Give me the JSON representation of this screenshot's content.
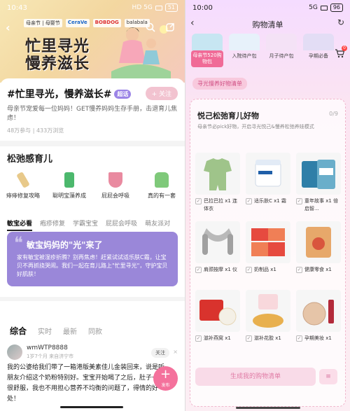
{
  "left": {
    "status": {
      "time": "10:43",
      "indicators": "HD 5G",
      "battery": "51"
    },
    "banner": {
      "brands": [
        "母亲节 | 母婴节",
        "CeraVe",
        "BOBDOG",
        "balabala"
      ],
      "title_line1": "忙里寻光",
      "title_line2": "慢养滋长"
    },
    "icons": {
      "back": "back-icon",
      "search": "search-icon",
      "share": "share-icon"
    },
    "topic": {
      "title": "#忙里寻光，慢养滋长#",
      "super_tag": "超话",
      "follow_label": "+ 关注",
      "description": "母亲节宠爱每一位妈妈！GET慢养妈妈生存手册，击退育儿焦虑！",
      "stats": "48万参与 | 433万浏览"
    },
    "section": {
      "title": "松弛感育儿",
      "items": [
        {
          "label": "痱痱修复攻略",
          "color": "#e8c98a"
        },
        {
          "label": "聪明宝藻养成",
          "color": "#4cb86d"
        },
        {
          "label": "屁屁会呼吸",
          "color": "#e98aa0"
        },
        {
          "label": "真的有一套",
          "color": "#7fc97a"
        }
      ]
    },
    "tabs": [
      "敏宝必看",
      "疱疹修复",
      "学霸宝宝",
      "屁屁会呼吸",
      "萌友派对"
    ],
    "promo": {
      "quote_mark": "❝",
      "title": "敏宝妈妈的\"光\"来了",
      "body": "家有敏宝被湿疹折腾？别再焦虑！赶紧试试适乐肤C霜，让宝贝不再抓挠哭闹。我们一起在育儿路上\"忙里寻光\"，守护宝贝好肌肤！"
    },
    "feed_tabs": [
      "综合",
      "实时",
      "最新",
      "同款"
    ],
    "post": {
      "username": "wmWTP8888",
      "meta": "1岁7个月  来自济宁市",
      "follow_label": "关注",
      "close": "×",
      "text": "我的公婆给我们带了一箱港版美素佳儿金装回来，说是听朋友介绍这个奶粉特别好。宝宝开始喝了之后，肚子一直很舒服，我也不用担心营养不均衡的问题了，得情的好处！"
    },
    "fab": {
      "plus": "+",
      "label": "发布"
    }
  },
  "right": {
    "status": {
      "time": "10:00",
      "indicators": "5G",
      "battery": "96"
    },
    "nav": {
      "back": "‹",
      "title": "购物清单",
      "refresh": "↻"
    },
    "gifts": [
      {
        "label": "母亲节520购物包",
        "color": "#c7e6f2"
      },
      {
        "label": "入院待产包",
        "color": "#e7f1fa"
      },
      {
        "label": "月子待产包",
        "color": "#f4e2f6"
      },
      {
        "label": "孕期必备",
        "color": "#e3ddf5"
      }
    ],
    "cart_badge": "0",
    "pill": "寻光慢养好物清单",
    "board": {
      "title": "悦己松弛育儿好物",
      "count": "0/9",
      "desc": "母亲节必pick好物，开启寻光悦己&慢养松弛养娃模式"
    },
    "items": [
      {
        "name": "巴拉巴拉 x1 连体衣",
        "color": "#9fc48a"
      },
      {
        "name": "适乐肤C x1 霜",
        "color": "#dfe9f5"
      },
      {
        "name": "童年故事 x1 倍启智...",
        "color": "#6aaeca"
      },
      {
        "name": "肩颈按摩 x1 仪",
        "color": "#c9c9c9"
      },
      {
        "name": "奶制品 x1",
        "color": "#e64a3f"
      },
      {
        "name": "健康零食 x1",
        "color": "#e7a86a"
      },
      {
        "name": "滋补燕窝 x1",
        "color": "#d9332d"
      },
      {
        "name": "滋补花胶 x1",
        "color": "#e8b04e"
      },
      {
        "name": "孕期美妆 x1",
        "color": "#e6c5a8"
      }
    ],
    "generate_label": "生成我的购物清单",
    "check_mark": "✓"
  }
}
